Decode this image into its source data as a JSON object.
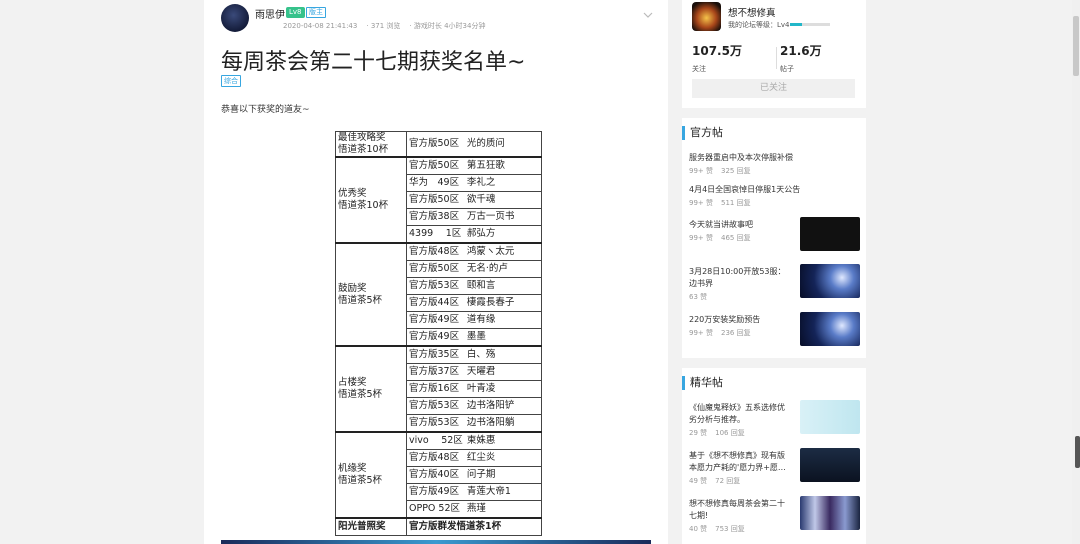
{
  "post": {
    "author": "雨思伊",
    "level_badge": "Lv8",
    "role_badge": "版主",
    "datetime": "2020-04-08 21:41:43",
    "views": "371 浏览",
    "game_time": "游戏时长 4小时34分钟",
    "title": "每周茶会第二十七期获奖名单~",
    "tag": "综合",
    "intro": "恭喜以下获奖的道友~"
  },
  "awards": [
    {
      "cat": "最佳攻略奖\n悟道茶10杯",
      "rows": [
        [
          "官方版50区",
          "光的质问"
        ]
      ]
    },
    {
      "cat": "优秀奖\n悟道茶10杯",
      "rows": [
        [
          "官方版50区",
          "第五狂歌"
        ],
        [
          "华为　49区",
          "李礼之"
        ],
        [
          "官方版50区",
          "欲千魂"
        ],
        [
          "官方版38区",
          "万古一页书"
        ],
        [
          "4399　 1区",
          "郝弘方"
        ]
      ]
    },
    {
      "cat": "鼓励奖\n悟道茶5杯",
      "rows": [
        [
          "官方版48区",
          "鸿蒙ヽ太元"
        ],
        [
          "官方版50区",
          "无名·的卢"
        ],
        [
          "官方版53区",
          "颐和言"
        ],
        [
          "官方版44区",
          "棲霞長春子"
        ],
        [
          "官方版49区",
          "道有缘"
        ],
        [
          "官方版49区",
          "墨墨"
        ]
      ]
    },
    {
      "cat": "占楼奖\n悟道茶5杯",
      "rows": [
        [
          "官方版35区",
          "白、殇"
        ],
        [
          "官方版37区",
          "天曜君"
        ],
        [
          "官方版16区",
          "叶青凌"
        ],
        [
          "官方版53区",
          "边书洛阳铲"
        ],
        [
          "官方版53区",
          "边书洛阳躺"
        ]
      ]
    },
    {
      "cat": "机缘奖\n悟道茶5杯",
      "rows": [
        [
          "vivo　 52区",
          "柬姝惠"
        ],
        [
          "官方版48区",
          "红尘炎"
        ],
        [
          "官方版40区",
          "问子期"
        ],
        [
          "官方版49区",
          "青莲大帝1"
        ],
        [
          "OPPO 52区",
          "燕瑾"
        ]
      ]
    }
  ],
  "awards_last": {
    "cat": "阳光普照奖",
    "text": "官方版群发悟道茶1杯"
  },
  "forum": {
    "name": "想不想修真",
    "level_label": "我的论坛等级：Lv4",
    "level_progress": 0.3,
    "followers_num": "107.5万",
    "followers_label": "关注",
    "posts_num": "21.6万",
    "posts_label": "帖子",
    "follow_button": "已关注"
  },
  "official": {
    "heading": "官方帖",
    "items": [
      {
        "title": "服务器重启中及本次停服补偿",
        "likes": "99+ 赞",
        "replies": "325 回复",
        "thumb": "none"
      },
      {
        "title": "4月4日全国哀悼日停服1天公告",
        "likes": "99+ 赞",
        "replies": "511 回复",
        "thumb": "none"
      },
      {
        "title": "今天就当讲故事吧",
        "likes": "99+ 赞",
        "replies": "465 回复",
        "thumb": "dark"
      },
      {
        "title": "3月28日10:00开放53服：边书界",
        "likes": "63 赞",
        "replies": "",
        "thumb": "game"
      },
      {
        "title": "220万安装奖励预告",
        "likes": "99+ 赞",
        "replies": "236 回复",
        "thumb": "game"
      }
    ]
  },
  "featured": {
    "heading": "精华帖",
    "items": [
      {
        "title": "《仙魔鬼释妖》五系选修优劣分析与推荐。",
        "likes": "29 赞",
        "replies": "106 回复",
        "thumb": "chars"
      },
      {
        "title": "基于《想不想修真》现有版本愿力产耗的'愿力界+愿…",
        "likes": "49 赞",
        "replies": "72 回复",
        "thumb": "ui"
      },
      {
        "title": "想不想修真每周茶会第二十七期!",
        "likes": "40 赞",
        "replies": "753 回复",
        "thumb": "posters"
      }
    ]
  },
  "colors": {
    "accent": "#37a6e0",
    "level_green": "#36c28b",
    "progress": "#22b7c9"
  }
}
